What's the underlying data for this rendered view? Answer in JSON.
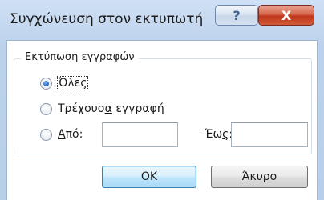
{
  "window": {
    "title": "Συγχώνευση στον εκτυπωτή",
    "help_glyph": "?",
    "close_glyph": "X"
  },
  "group": {
    "legend": "Εκτύπωση εγγραφών"
  },
  "options": {
    "all": {
      "label": "Όλες",
      "selected": true
    },
    "current": {
      "label_pre": "Τρέχουσ",
      "label_accel": "α",
      "label_post": " εγγραφή",
      "selected": false
    },
    "from": {
      "label_accel": "Α",
      "label_post": "πό:",
      "selected": false
    }
  },
  "range": {
    "from_value": "",
    "to_label_pre": "Έω",
    "to_label_accel": "ς",
    "to_label_post": ":",
    "to_value": ""
  },
  "buttons": {
    "ok": "OK",
    "cancel": "Άκυρο"
  }
}
